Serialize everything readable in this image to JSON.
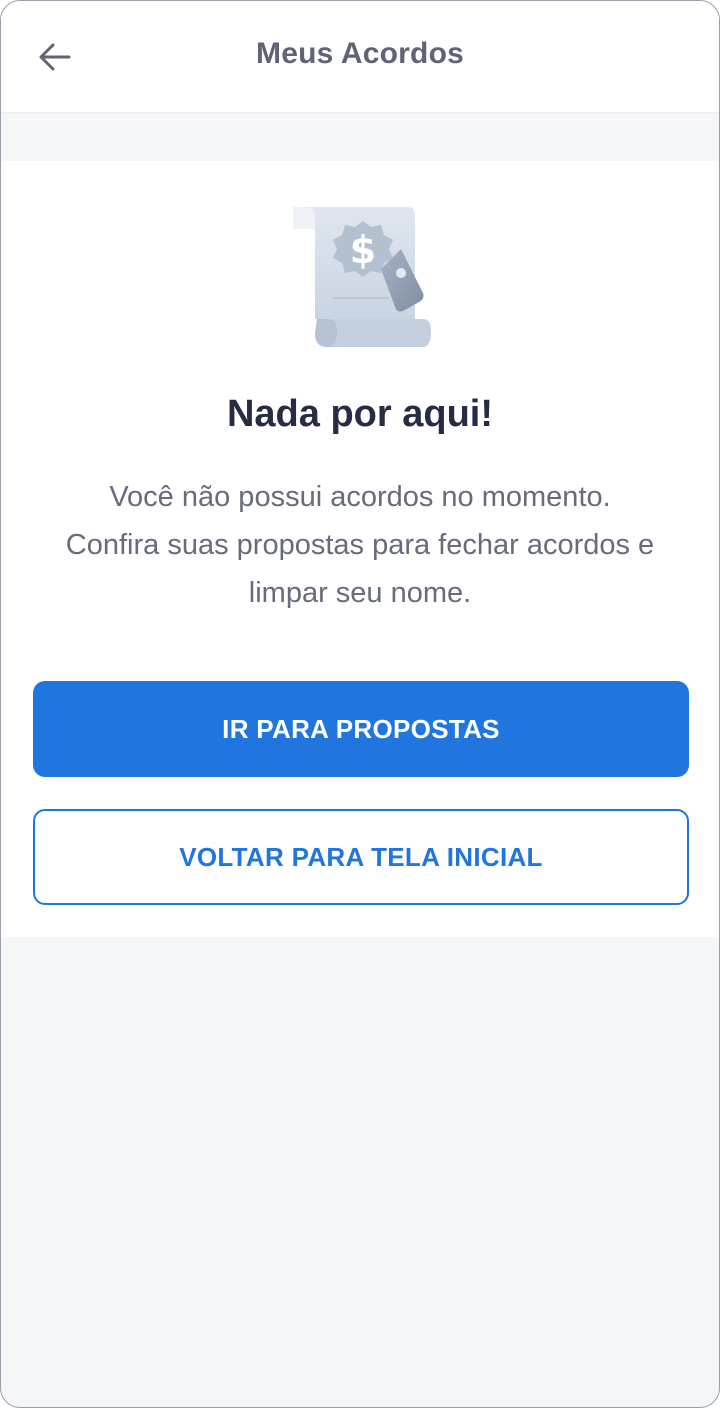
{
  "header": {
    "title": "Meus Acordos",
    "back_icon": "arrow-left-icon"
  },
  "empty_state": {
    "illustration_icon": "receipt-dollar-tag-icon",
    "title": "Nada por aqui!",
    "message_line1": "Você não possui acordos no momento.",
    "message_line2": "Confira suas propostas para fechar acordos e",
    "message_line3": "limpar seu nome."
  },
  "actions": {
    "primary_label": "IR PARA PROPOSTAS",
    "secondary_label": "VOLTAR PARA TELA INICIAL"
  },
  "colors": {
    "primary": "#2075de",
    "title_text": "#262c44",
    "body_text": "#676b7c",
    "background": "#f5f6f8"
  }
}
